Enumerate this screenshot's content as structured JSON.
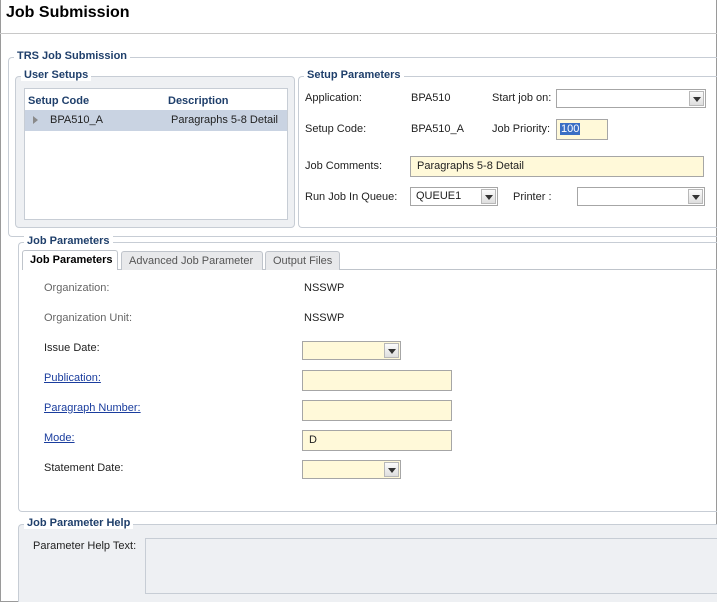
{
  "page": {
    "title": "Job Submission"
  },
  "trs": {
    "legend": "TRS Job Submission"
  },
  "user_setups": {
    "legend": "User Setups",
    "columns": {
      "setup_code": "Setup Code",
      "description": "Description"
    },
    "rows": [
      {
        "setup_code": "BPA510_A",
        "description": "Paragraphs 5-8 Detail"
      }
    ]
  },
  "setup_parameters": {
    "legend": "Setup Parameters",
    "application_label": "Application:",
    "application_value": "BPA510",
    "start_job_label": "Start job on:",
    "start_job_value": "",
    "setup_code_label": "Setup Code:",
    "setup_code_value": "BPA510_A",
    "job_priority_label": "Job Priority:",
    "job_priority_value": "100",
    "job_comments_label": "Job Comments:",
    "job_comments_value": "Paragraphs 5-8 Detail",
    "run_job_label": "Run Job In Queue:",
    "run_job_value": "QUEUE1",
    "printer_label": "Printer :",
    "printer_value": ""
  },
  "job_parameters": {
    "legend": "Job Parameters",
    "tabs": [
      {
        "label": "Job Parameters",
        "active": true
      },
      {
        "label": "Advanced Job Parameter",
        "active": false
      },
      {
        "label": "Output Files",
        "active": false
      }
    ],
    "organization_label": "Organization:",
    "organization_value": "NSSWP",
    "org_unit_label": "Organization Unit:",
    "org_unit_value": "NSSWP",
    "issue_date_label": "Issue Date:",
    "issue_date_value": "",
    "publication_label": "Publication:",
    "publication_value": "",
    "paragraph_label": "Paragraph Number:",
    "paragraph_value": "",
    "mode_label": "Mode:",
    "mode_value": "D",
    "statement_date_label": "Statement Date:",
    "statement_date_value": ""
  },
  "help": {
    "legend": "Job Parameter Help",
    "text_label": "Parameter Help Text:",
    "text_value": ""
  },
  "colors": {
    "accent": "#1f3f6b",
    "input_yellow": "#fff9d9",
    "selected_row": "#c9d3e2",
    "link": "#1a3d9e"
  }
}
